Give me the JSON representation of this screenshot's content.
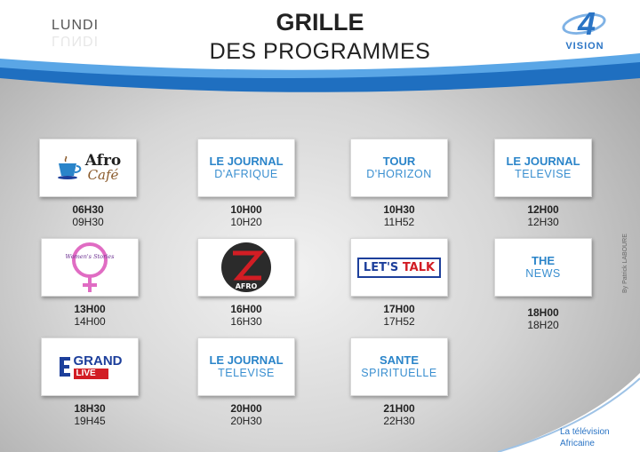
{
  "header": {
    "day": "LUNDI",
    "title_line1": "GRILLE",
    "title_line2": "DES PROGRAMMES",
    "logo_number": "4",
    "logo_word": "VISION"
  },
  "programs": [
    {
      "logo": "afro-cafe-logo",
      "line1": "Afro",
      "line2": "Café",
      "start": "06H30",
      "end": "09H30"
    },
    {
      "line1": "LE JOURNAL",
      "line2": "D'AFRIQUE",
      "start": "10H00",
      "end": "10H20"
    },
    {
      "line1": "TOUR",
      "line2": "D'HORIZON",
      "start": "10H30",
      "end": "11H52"
    },
    {
      "line1": "LE JOURNAL",
      "line2": "TELEVISE",
      "start": "12H00",
      "end": "12H30"
    },
    {
      "logo": "womens-stories-logo",
      "line1": "Women's Stories",
      "start": "13H00",
      "end": "14H00"
    },
    {
      "logo": "afro-z-logo",
      "line1": "AFRO",
      "start": "16H00",
      "end": "16H30"
    },
    {
      "logo": "lets-talk-logo",
      "line1": "LET'S",
      "line2": "TALK",
      "start": "17H00",
      "end": "17H52"
    },
    {
      "line1": "THE",
      "line2": "NEWS",
      "start": "18H00",
      "end": "18H20"
    },
    {
      "logo": "le-grand-live-logo",
      "line1": "GRAND",
      "line2": "LIVE",
      "start": "18H30",
      "end": "19H45"
    },
    {
      "line1": "LE JOURNAL",
      "line2": "TELEVISE",
      "start": "20H00",
      "end": "20H30"
    },
    {
      "line1": "SANTE",
      "line2": "SPIRITUELLE",
      "start": "21H00",
      "end": "22H30"
    }
  ],
  "footer": {
    "line1": "La télévision",
    "line2": "Africaine",
    "credit": "By Patrick LABOURE"
  },
  "colors": {
    "accent": "#2a84c9",
    "dark_blue": "#1d3f9b",
    "red": "#d21d24"
  }
}
